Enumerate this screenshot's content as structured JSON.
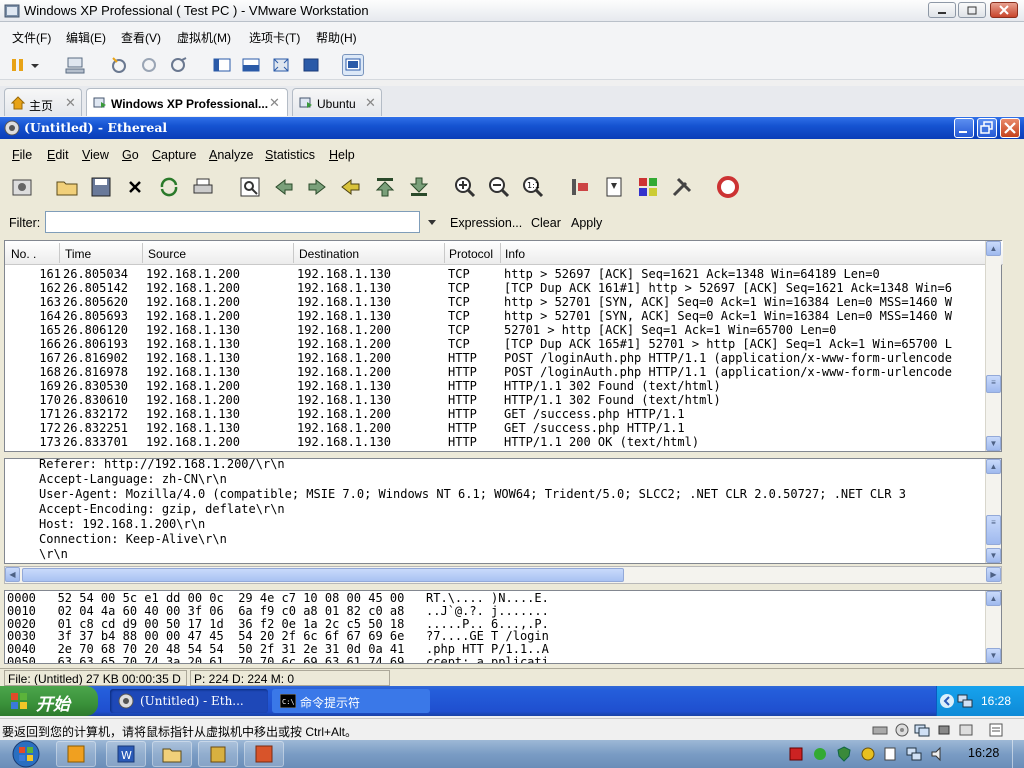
{
  "vmware": {
    "window_title": "Windows XP Professional ( Test PC ) - VMware Workstation",
    "menu": [
      "文件(F)",
      "编辑(E)",
      "查看(V)",
      "虚拟机(M)",
      "选项卡(T)",
      "帮助(H)"
    ],
    "tabs": [
      "主页",
      "Windows XP Professional...",
      "Ubuntu"
    ],
    "status_message": "要返回到您的计算机，请将鼠标指针从虚拟机中移出或按 Ctrl+Alt。"
  },
  "ethereal": {
    "title": "(Untitled) - Ethereal",
    "menu": [
      {
        "first": "F",
        "rest": "ile"
      },
      {
        "first": "E",
        "rest": "dit"
      },
      {
        "first": "V",
        "rest": "iew"
      },
      {
        "first": "G",
        "rest": "o"
      },
      {
        "first": "C",
        "rest": "apture"
      },
      {
        "first": "A",
        "rest": "nalyze"
      },
      {
        "first": "S",
        "rest": "tatistics"
      },
      {
        "first": "H",
        "rest": "elp"
      }
    ],
    "filter": {
      "label": "Filter:",
      "value": "",
      "expression_label": "Expression...",
      "clear_label": "Clear",
      "apply_label": "Apply"
    },
    "columns": [
      "No. .",
      "Time",
      "Source",
      "Destination",
      "Protocol",
      "Info"
    ],
    "packets": [
      {
        "no": "161",
        "time": "26.805034",
        "src": "192.168.1.200",
        "dst": "192.168.1.130",
        "proto": "TCP",
        "info": "http > 52697 [ACK] Seq=1621 Ack=1348 Win=64189 Len=0"
      },
      {
        "no": "162",
        "time": "26.805142",
        "src": "192.168.1.200",
        "dst": "192.168.1.130",
        "proto": "TCP",
        "info": "[TCP Dup ACK 161#1] http > 52697 [ACK] Seq=1621 Ack=1348 Win=6"
      },
      {
        "no": "163",
        "time": "26.805620",
        "src": "192.168.1.200",
        "dst": "192.168.1.130",
        "proto": "TCP",
        "info": "http > 52701 [SYN, ACK] Seq=0 Ack=1 Win=16384 Len=0 MSS=1460 W"
      },
      {
        "no": "164",
        "time": "26.805693",
        "src": "192.168.1.200",
        "dst": "192.168.1.130",
        "proto": "TCP",
        "info": "http > 52701 [SYN, ACK] Seq=0 Ack=1 Win=16384 Len=0 MSS=1460 W"
      },
      {
        "no": "165",
        "time": "26.806120",
        "src": "192.168.1.130",
        "dst": "192.168.1.200",
        "proto": "TCP",
        "info": "52701 > http [ACK] Seq=1 Ack=1 Win=65700 Len=0"
      },
      {
        "no": "166",
        "time": "26.806193",
        "src": "192.168.1.130",
        "dst": "192.168.1.200",
        "proto": "TCP",
        "info": "[TCP Dup ACK 165#1] 52701 > http [ACK] Seq=1 Ack=1 Win=65700 L"
      },
      {
        "no": "167",
        "time": "26.816902",
        "src": "192.168.1.130",
        "dst": "192.168.1.200",
        "proto": "HTTP",
        "info": "POST /loginAuth.php HTTP/1.1 (application/x-www-form-urlencode"
      },
      {
        "no": "168",
        "time": "26.816978",
        "src": "192.168.1.130",
        "dst": "192.168.1.200",
        "proto": "HTTP",
        "info": "POST /loginAuth.php HTTP/1.1 (application/x-www-form-urlencode"
      },
      {
        "no": "169",
        "time": "26.830530",
        "src": "192.168.1.200",
        "dst": "192.168.1.130",
        "proto": "HTTP",
        "info": "HTTP/1.1 302 Found (text/html)"
      },
      {
        "no": "170",
        "time": "26.830610",
        "src": "192.168.1.200",
        "dst": "192.168.1.130",
        "proto": "HTTP",
        "info": "HTTP/1.1 302 Found (text/html)"
      },
      {
        "no": "171",
        "time": "26.832172",
        "src": "192.168.1.130",
        "dst": "192.168.1.200",
        "proto": "HTTP",
        "info": "GET /success.php HTTP/1.1"
      },
      {
        "no": "172",
        "time": "26.832251",
        "src": "192.168.1.130",
        "dst": "192.168.1.200",
        "proto": "HTTP",
        "info": "GET /success.php HTTP/1.1"
      },
      {
        "no": "173",
        "time": "26.833701",
        "src": "192.168.1.200",
        "dst": "192.168.1.130",
        "proto": "HTTP",
        "info": "HTTP/1.1 200 OK (text/html)"
      }
    ],
    "details": [
      "Referer: http://192.168.1.200/\\r\\n",
      "Accept-Language: zh-CN\\r\\n",
      "User-Agent: Mozilla/4.0 (compatible; MSIE 7.0; Windows NT 6.1; WOW64; Trident/5.0; SLCC2; .NET CLR 2.0.50727; .NET CLR 3",
      "Accept-Encoding: gzip, deflate\\r\\n",
      "Host: 192.168.1.200\\r\\n",
      "Connection: Keep-Alive\\r\\n",
      "\\r\\n"
    ],
    "hex": [
      "0000   52 54 00 5c e1 dd 00 0c  29 4e c7 10 08 00 45 00   RT.\\.... )N....E.",
      "0010   02 04 4a 60 40 00 3f 06  6a f9 c0 a8 01 82 c0 a8   ..J`@.?. j.......",
      "0020   01 c8 cd d9 00 50 17 1d  36 f2 0e 1a 2c c5 50 18   .....P.. 6...,.P.",
      "0030   3f 37 b4 88 00 00 47 45  54 20 2f 6c 6f 67 69 6e   ?7....GE T /login",
      "0040   2e 70 68 70 20 48 54 54  50 2f 31 2e 31 0d 0a 41   .php HTT P/1.1..A",
      "0050   63 63 65 70 74 3a 20 61  70 70 6c 69 63 61 74 69   ccept: a pplicati"
    ],
    "status_file": "File: (Untitled) 27 KB 00:00:35 D",
    "status_packets": "P: 224 D: 224 M: 0"
  },
  "xp_taskbar": {
    "start_label": "开始",
    "items": [
      "(Untitled) - Eth...",
      "命令提示符"
    ],
    "clock": "16:28"
  },
  "win7_taskbar": {
    "clock": "16:28"
  },
  "colors": {
    "xp_title_blue": "#1553d1",
    "xp_taskbar_blue": "#245edb",
    "xp_start_green": "#3a913a",
    "selection_none": "#ffffff"
  }
}
